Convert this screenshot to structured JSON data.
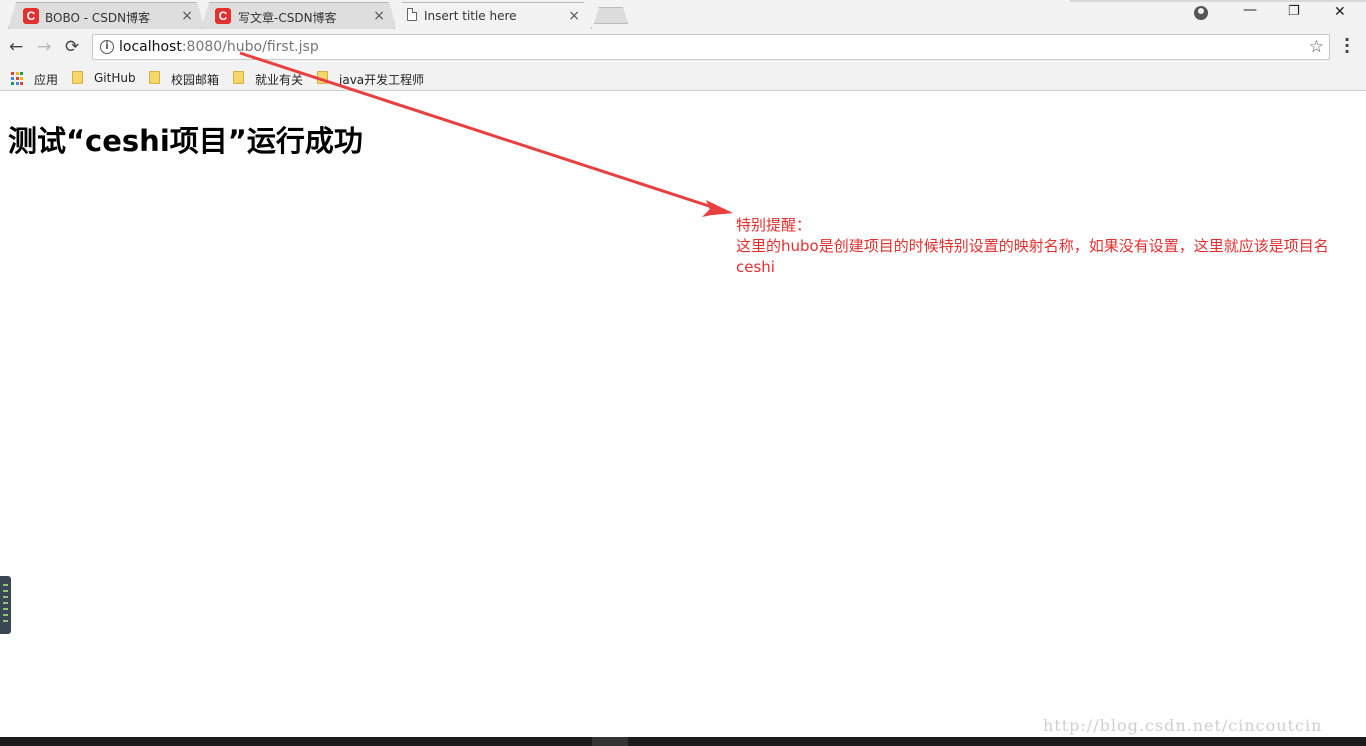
{
  "browser": {
    "tabs": [
      {
        "title": "BOBO - CSDN博客",
        "icon": "csdn-icon",
        "active": false
      },
      {
        "title": "写文章-CSDN博客",
        "icon": "csdn-icon",
        "active": false
      },
      {
        "title": "Insert title here",
        "icon": "document-icon",
        "active": true
      }
    ],
    "close_glyph": "×",
    "window_controls": {
      "minimize": "—",
      "restore": "❐",
      "close": "✕"
    }
  },
  "toolbar": {
    "back": "←",
    "forward": "→",
    "reload": "⟳",
    "url_host": "localhost",
    "url_rest": ":8080/hubo/first.jsp",
    "star": "☆"
  },
  "bookmarks": [
    {
      "label": "应用",
      "icon": "apps-grid-icon"
    },
    {
      "label": "GitHub",
      "icon": "folder-icon"
    },
    {
      "label": "校园邮箱",
      "icon": "folder-icon"
    },
    {
      "label": "就业有关",
      "icon": "folder-icon"
    },
    {
      "label": "java开发工程师",
      "icon": "folder-icon"
    }
  ],
  "page": {
    "heading": "测试“ceshi项目”运行成功"
  },
  "annotation": {
    "line1": "特别提醒：",
    "line2": "这里的hubo是创建项目的时候特别设置的映射名称，如果没有设置，这里就应该是项目名",
    "line3": "ceshi",
    "color": "#e3302f"
  },
  "watermark": "http://blog.csdn.net/cincoutcin"
}
